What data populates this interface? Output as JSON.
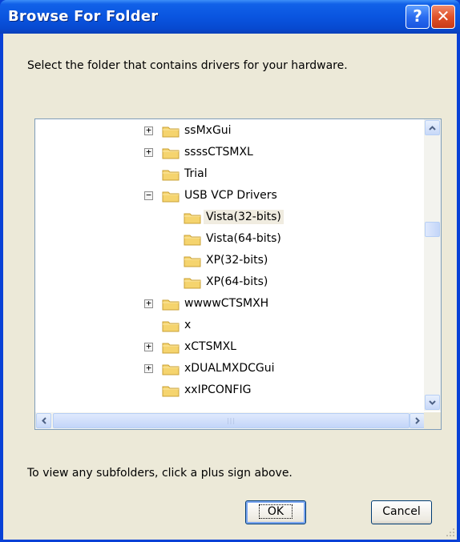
{
  "window": {
    "title": "Browse For Folder"
  },
  "titlebar": {
    "help_label": "?",
    "close_label": "✕"
  },
  "prompt": "Select the folder that contains drivers for your hardware.",
  "tree": {
    "items": [
      {
        "label": "ssMxGui",
        "expander": "+"
      },
      {
        "label": "ssssCTSMXL",
        "expander": "+"
      },
      {
        "label": "Trial",
        "expander": ""
      },
      {
        "label": "USB VCP Drivers",
        "expander": "−"
      },
      {
        "label": "Vista(32-bits)",
        "expander": "",
        "selected": true
      },
      {
        "label": "Vista(64-bits)",
        "expander": ""
      },
      {
        "label": "XP(32-bits)",
        "expander": ""
      },
      {
        "label": "XP(64-bits)",
        "expander": ""
      },
      {
        "label": "wwwwCTSMXH",
        "expander": "+"
      },
      {
        "label": "x",
        "expander": ""
      },
      {
        "label": "xCTSMXL",
        "expander": "+"
      },
      {
        "label": "xDUALMXDCGui",
        "expander": "+"
      },
      {
        "label": "xxIPCONFIG",
        "expander": ""
      }
    ]
  },
  "hint": "To view any subfolders, click a plus sign above.",
  "buttons": {
    "ok": "OK",
    "cancel": "Cancel"
  },
  "colors": {
    "title_bar": "#0a55e0",
    "dialog_bg": "#ece9d8",
    "folder": "#f5d46e"
  }
}
